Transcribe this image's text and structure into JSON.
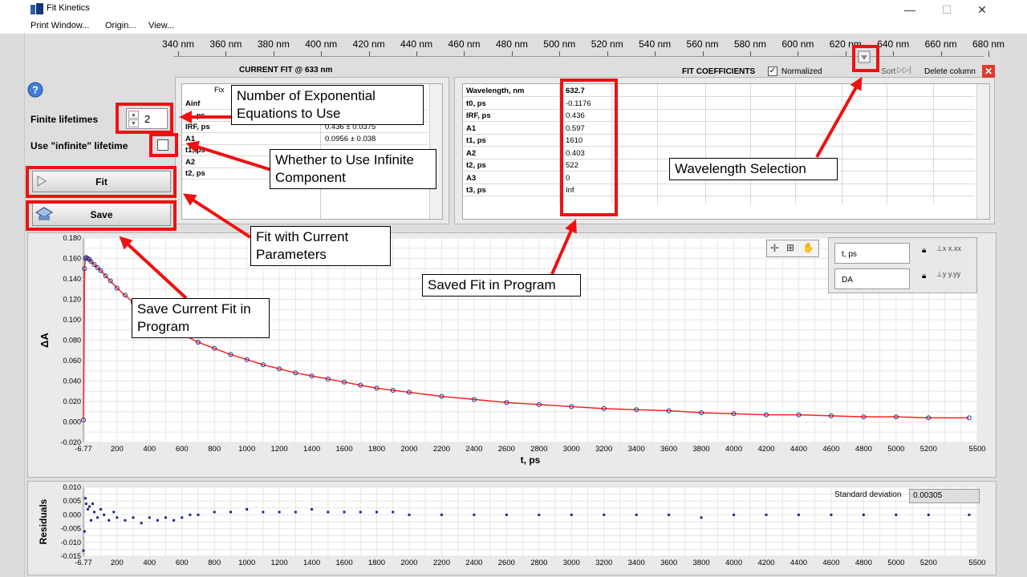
{
  "window": {
    "title": "Fit Kinetics",
    "minimize": "—",
    "maximize": "☐",
    "close": "✕"
  },
  "menu": [
    "Print Window...",
    "Origin...",
    "View..."
  ],
  "wavelength_scale": [
    "340 nm",
    "360 nm",
    "380 nm",
    "400 nm",
    "420 nm",
    "440 nm",
    "460 nm",
    "480 nm",
    "500 nm",
    "520 nm",
    "540 nm",
    "560 nm",
    "580 nm",
    "600 nm",
    "620 nm",
    "640 nm",
    "660 nm",
    "680 nm"
  ],
  "current_fit": {
    "header": "CURRENT FIT @  633  nm",
    "column_header": "Fix",
    "rows": [
      {
        "name": "Ainf",
        "value": ""
      },
      {
        "name": "t0, ps",
        "value": ""
      },
      {
        "name": "IRF, ps",
        "value": "0.436 ± 0.0375"
      },
      {
        "name": "A1",
        "value": "0.0956 ± 0.038"
      },
      {
        "name": "t1, ps",
        "value": ""
      },
      {
        "name": "A2",
        "value": ""
      },
      {
        "name": "t2, ps",
        "value": ""
      }
    ]
  },
  "fit_coefficients": {
    "header": "FIT COEFFICIENTS",
    "normalized_label": "Normalized",
    "normalized_checked": true,
    "sort_label": "Sort",
    "delete_label": "Delete column",
    "rows": [
      {
        "name": "Wavelength, nm",
        "value": "632.7"
      },
      {
        "name": "t0, ps",
        "value": "-0.1176"
      },
      {
        "name": "IRF, ps",
        "value": "0.436"
      },
      {
        "name": "A1",
        "value": "0.597"
      },
      {
        "name": "t1, ps",
        "value": "1610"
      },
      {
        "name": "A2",
        "value": "0.403"
      },
      {
        "name": "t2, ps",
        "value": "522"
      },
      {
        "name": "A3",
        "value": "0"
      },
      {
        "name": "t3, ps",
        "value": "Inf"
      }
    ]
  },
  "controls": {
    "finite_lifetimes_label": "Finite lifetimes",
    "finite_lifetimes_value": "2",
    "infinite_label": "Use \"infinite\" lifetime",
    "infinite_checked": false,
    "fit_label": "Fit",
    "save_label": "Save",
    "help_glyph": "?"
  },
  "legend_panel": {
    "x_name": "t, ps",
    "y_name": "DA"
  },
  "residuals_panel": {
    "std_label": "Standard deviation",
    "std_value": "0.00305"
  },
  "annotations": {
    "exp_eq": "Number of Exponential Equations to Use",
    "infinite": "Whether to Use Infinite Component",
    "fit": "Fit with Current Parameters",
    "save": "Save Current Fit in Program",
    "saved": "Saved Fit in Program",
    "wavelength": "Wavelength Selection"
  },
  "colors": {
    "fit_line": "#ff2020",
    "data_points": "#1f2a8c",
    "annotation": "#ee1111"
  },
  "chart_data": [
    {
      "type": "scatter",
      "title": "",
      "xlabel": "t, ps",
      "ylabel": "ΔA",
      "xlim": [
        -6.77,
        5500
      ],
      "ylim": [
        -0.02,
        0.18
      ],
      "xticks": [
        "-6.77",
        "200",
        "400",
        "600",
        "800",
        "1000",
        "1200",
        "1400",
        "1600",
        "1800",
        "2000",
        "2200",
        "2400",
        "2600",
        "2800",
        "3000",
        "3200",
        "3400",
        "3600",
        "3800",
        "4000",
        "4200",
        "4400",
        "4600",
        "4800",
        "5000",
        "5200",
        "5500"
      ],
      "yticks": [
        "0.180",
        "0.160",
        "0.140",
        "0.120",
        "0.100",
        "0.080",
        "0.060",
        "0.040",
        "0.020",
        "0.000",
        "-0.020"
      ],
      "grid": true,
      "series": [
        {
          "x": [
            -6.77,
            0,
            5,
            10,
            20,
            30,
            40,
            60,
            80,
            100,
            130,
            160,
            200,
            250,
            300,
            350,
            400,
            500,
            600,
            700,
            800,
            900,
            1000,
            1100,
            1200,
            1300,
            1400,
            1500,
            1600,
            1700,
            1800,
            1900,
            2000,
            2200,
            2400,
            2600,
            2800,
            3000,
            3200,
            3400,
            3600,
            3800,
            4000,
            4200,
            4400,
            4600,
            4800,
            5000,
            5200,
            5450
          ],
          "y": [
            0.002,
            0.15,
            0.16,
            0.161,
            0.16,
            0.159,
            0.157,
            0.154,
            0.151,
            0.148,
            0.143,
            0.138,
            0.131,
            0.124,
            0.117,
            0.111,
            0.105,
            0.095,
            0.086,
            0.078,
            0.072,
            0.066,
            0.061,
            0.056,
            0.052,
            0.048,
            0.045,
            0.042,
            0.039,
            0.036,
            0.033,
            0.031,
            0.029,
            0.025,
            0.022,
            0.019,
            0.017,
            0.015,
            0.013,
            0.012,
            0.011,
            0.009,
            0.008,
            0.007,
            0.007,
            0.006,
            0.005,
            0.005,
            0.004,
            0.004
          ]
        }
      ]
    },
    {
      "type": "scatter",
      "title": "",
      "xlabel": "",
      "ylabel": "Residuals",
      "xlim": [
        -6.77,
        5500
      ],
      "ylim": [
        -0.015,
        0.01
      ],
      "yticks": [
        "0.010",
        "0.005",
        "0.000",
        "-0.005",
        "-0.010",
        "-0.015"
      ],
      "xticks": [
        "-6.77",
        "200",
        "400",
        "600",
        "800",
        "1000",
        "1200",
        "1400",
        "1600",
        "1800",
        "2000",
        "2200",
        "2400",
        "2600",
        "2800",
        "3000",
        "3200",
        "3400",
        "3600",
        "3800",
        "4000",
        "4200",
        "4400",
        "4600",
        "4800",
        "5000",
        "5200",
        "5500"
      ],
      "grid": true,
      "series": [
        {
          "x": [
            -6.77,
            0,
            5,
            10,
            20,
            30,
            40,
            50,
            60,
            80,
            100,
            120,
            150,
            180,
            200,
            250,
            300,
            350,
            400,
            450,
            500,
            550,
            600,
            650,
            700,
            800,
            900,
            1000,
            1100,
            1200,
            1300,
            1400,
            1500,
            1600,
            1700,
            1800,
            1900,
            2000,
            2200,
            2400,
            2600,
            2800,
            3000,
            3200,
            3400,
            3600,
            3800,
            4000,
            4200,
            4400,
            4600,
            4800,
            5000,
            5200,
            5450
          ],
          "y": [
            -0.013,
            -0.006,
            0.006,
            0.004,
            0.002,
            0.003,
            -0.002,
            0.004,
            0.001,
            -0.001,
            0.002,
            0.0,
            -0.002,
            0.001,
            -0.001,
            -0.002,
            -0.001,
            -0.003,
            -0.001,
            -0.002,
            -0.001,
            -0.002,
            -0.001,
            0.0,
            0.0,
            0.001,
            0.001,
            0.002,
            0.001,
            0.001,
            0.001,
            0.002,
            0.001,
            0.001,
            0.001,
            0.001,
            0.001,
            0.0,
            0.0,
            0.0,
            0.0,
            0.0,
            0.0,
            0.0,
            0.0,
            0.0,
            -0.001,
            0.0,
            0.0,
            0.0,
            0.0,
            0.0,
            0.0,
            0.0,
            0.0
          ]
        }
      ]
    }
  ]
}
